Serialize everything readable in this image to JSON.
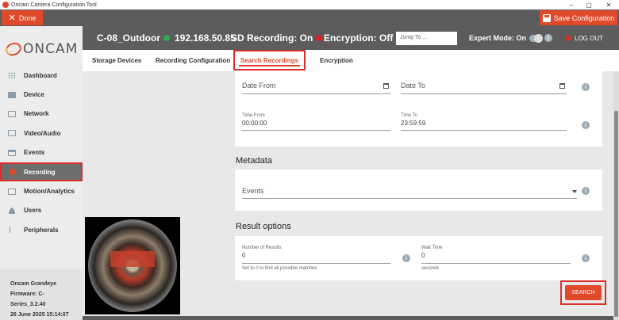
{
  "window": {
    "title": "Oncam Camera Configuration Tool",
    "controls": [
      "–",
      "▢",
      "✕"
    ]
  },
  "toolbar": {
    "done_label": "Done",
    "save_label": "Save Configuration",
    "accent_color": "#e04a2a"
  },
  "logo": {
    "text": "ONCAM"
  },
  "sidebar": {
    "items": [
      {
        "label": "Dashboard",
        "icon": "grid-icon",
        "active": false
      },
      {
        "label": "Device",
        "icon": "camera-icon",
        "active": false
      },
      {
        "label": "Network",
        "icon": "network-icon",
        "active": false
      },
      {
        "label": "Video/Audio",
        "icon": "video-icon",
        "active": false
      },
      {
        "label": "Events",
        "icon": "calendar-icon",
        "active": false
      },
      {
        "label": "Recording",
        "icon": "record-dot-icon",
        "active": true
      },
      {
        "label": "Motion/Analytics",
        "icon": "motion-icon",
        "active": false
      },
      {
        "label": "Users",
        "icon": "user-icon",
        "active": false
      },
      {
        "label": "Peripherals",
        "icon": "usb-icon",
        "active": false
      }
    ],
    "device_info": {
      "model": "Oncam Grandeye",
      "firmware_line1": "Firmware: C-",
      "firmware_line2": "Series_3.2.40",
      "datetime": "26 June 2025 15:14:07"
    }
  },
  "header": {
    "camera_name": "C-08_Outdoor",
    "camera_status_color": "#2fa84f",
    "ip": "192.168.50.85",
    "sd_recording": "SD Recording: On",
    "sd_status_color": "#e02020",
    "encryption": "Encryption: Off",
    "encryption_status_color": "#ffffff",
    "jump_placeholder": "Jump To ...",
    "expert_mode": "Expert Mode: On",
    "logout": "LOG OUT"
  },
  "tabs": [
    {
      "label": "Storage Devices",
      "active": false
    },
    {
      "label": "Recording Configuration",
      "active": false
    },
    {
      "label": "Search Recordings",
      "active": true
    },
    {
      "label": "Encryption",
      "active": false
    }
  ],
  "search": {
    "date_from": "Date From",
    "date_to": "Date To",
    "time_from_label": "Time From",
    "time_from_value": "00:00:00",
    "time_to_label": "Time To",
    "time_to_value": "23:59:59"
  },
  "metadata": {
    "title": "Metadata",
    "events_placeholder": "Events"
  },
  "result_options": {
    "title": "Result options",
    "num_results_label": "Number of Results",
    "num_results_value": "0",
    "num_results_help": "Set to 0 to find all possible matches",
    "wait_time_label": "Wait Time",
    "wait_time_value": "0",
    "wait_time_help": "seconds",
    "search_button": "SEARCH"
  }
}
